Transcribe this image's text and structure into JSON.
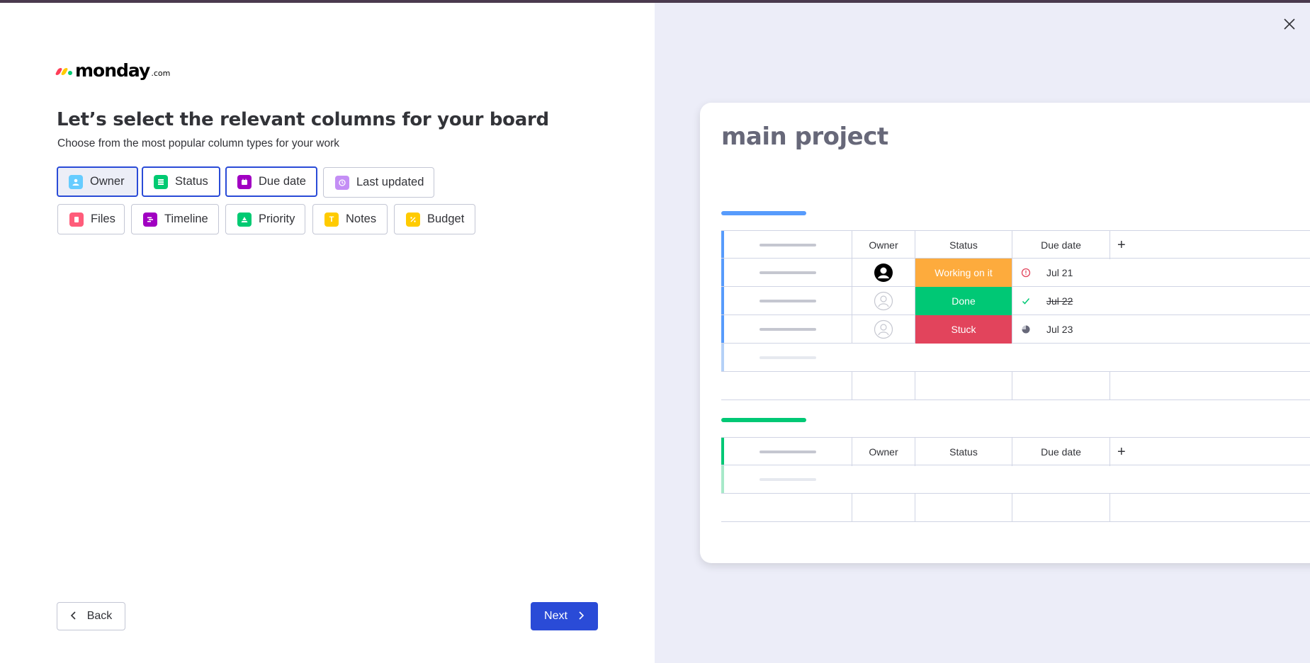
{
  "logo": {
    "text": "monday",
    "suffix": ".com",
    "mark_colors": [
      "#ff3d57",
      "#ffcb00",
      "#00ca72"
    ]
  },
  "heading": {
    "title": "Let’s select the relevant columns for your board",
    "subtitle": "Choose from the most popular column types for your work"
  },
  "columns": [
    {
      "label": "Owner",
      "selected": true,
      "icon": "person-icon",
      "color": "#66ccff"
    },
    {
      "label": "Status",
      "selected": true,
      "icon": "status-icon",
      "color": "#00ca72"
    },
    {
      "label": "Due date",
      "selected": true,
      "icon": "calendar-icon",
      "color": "#a100c2"
    },
    {
      "label": "Last updated",
      "selected": false,
      "icon": "clock-icon",
      "color": "#c48ef5"
    },
    {
      "label": "Files",
      "selected": false,
      "icon": "file-icon",
      "color": "#ff5c7a"
    },
    {
      "label": "Timeline",
      "selected": false,
      "icon": "timeline-icon",
      "color": "#a100c2"
    },
    {
      "label": "Priority",
      "selected": false,
      "icon": "priority-icon",
      "color": "#00ca72"
    },
    {
      "label": "Notes",
      "selected": false,
      "icon": "text-icon",
      "color": "#ffcb00"
    },
    {
      "label": "Budget",
      "selected": false,
      "icon": "budget-icon",
      "color": "#ffcb00"
    }
  ],
  "footer": {
    "back_label": "Back",
    "next_label": "Next"
  },
  "preview": {
    "board_title": "main project",
    "group1": {
      "color": "#579bfc",
      "headers": [
        "Owner",
        "Status",
        "Due date"
      ],
      "plus": "+",
      "rows": [
        {
          "status": "Working on it",
          "status_color": "#fdab3d",
          "date": "Jul 21",
          "date_icon": "alert-icon",
          "struck": false,
          "owner": "filled"
        },
        {
          "status": "Done",
          "status_color": "#00c875",
          "date": "Jul 22",
          "date_icon": "check-icon",
          "struck": true,
          "owner": "empty"
        },
        {
          "status": "Stuck",
          "status_color": "#e2445c",
          "date": "Jul 23",
          "date_icon": "half-circle-icon",
          "struck": false,
          "owner": "empty"
        }
      ]
    },
    "group2": {
      "color": "#00c875",
      "headers": [
        "Owner",
        "Status",
        "Due date"
      ],
      "plus": "+"
    }
  }
}
